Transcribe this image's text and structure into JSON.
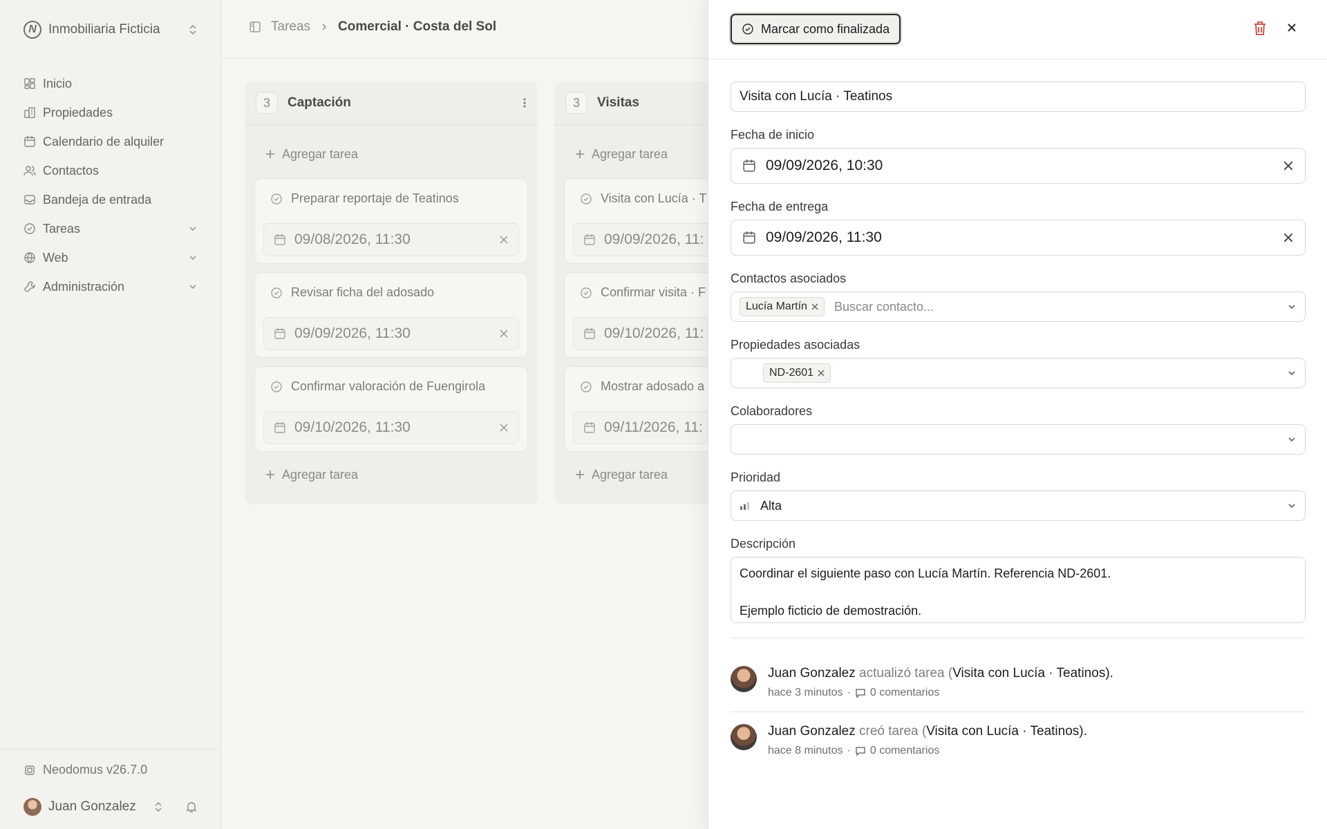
{
  "sidebar": {
    "org_name": "Inmobiliaria Ficticia",
    "logo_letter": "N",
    "nav": [
      {
        "label": "Inicio",
        "icon": "dashboard-icon"
      },
      {
        "label": "Propiedades",
        "icon": "building-icon"
      },
      {
        "label": "Calendario de alquiler",
        "icon": "calendar-icon"
      },
      {
        "label": "Contactos",
        "icon": "users-icon"
      },
      {
        "label": "Bandeja de entrada",
        "icon": "inbox-icon"
      },
      {
        "label": "Tareas",
        "icon": "check-circle-icon",
        "expandable": true
      },
      {
        "label": "Web",
        "icon": "globe-icon",
        "expandable": true
      },
      {
        "label": "Administración",
        "icon": "wrench-icon",
        "expandable": true
      }
    ],
    "version": "Neodomus v26.7.0",
    "user_name": "Juan Gonzalez"
  },
  "breadcrumb": {
    "parent": "Tareas",
    "current": "Comercial · Costa del Sol"
  },
  "board": {
    "add_task_label": "Agregar tarea",
    "columns": [
      {
        "count": "3",
        "title": "Captación",
        "cards": [
          {
            "title": "Preparar reportaje de Teatinos",
            "date": "09/08/2026, 11:30"
          },
          {
            "title": "Revisar ficha del adosado",
            "date": "09/09/2026, 11:30"
          },
          {
            "title": "Confirmar valoración de Fuengirola",
            "date": "09/10/2026, 11:30"
          }
        ]
      },
      {
        "count": "3",
        "title": "Visitas",
        "cards": [
          {
            "title": "Visita con Lucía · T",
            "date": "09/09/2026, 11:"
          },
          {
            "title": "Confirmar visita · F",
            "date": "09/10/2026, 11:"
          },
          {
            "title": "Mostrar adosado a",
            "date": "09/11/2026, 11:"
          }
        ]
      }
    ]
  },
  "panel": {
    "finish_label": "Marcar como finalizada",
    "task_title": "Visita con Lucía · Teatinos",
    "start_label": "Fecha de inicio",
    "start_value": "09/09/2026, 10:30",
    "due_label": "Fecha de entrega",
    "due_value": "09/09/2026, 11:30",
    "contacts_label": "Contactos asociados",
    "contact_chip": "Lucía Martín",
    "contact_placeholder": "Buscar contacto...",
    "properties_label": "Propiedades asociadas",
    "property_chip": "ND-2601",
    "collaborators_label": "Colaboradores",
    "priority_label": "Prioridad",
    "priority_value": "Alta",
    "description_label": "Descripción",
    "description_line1": "Coordinar el siguiente paso con Lucía Martín. Referencia ND-2601.",
    "description_line2": "Ejemplo ficticio de demostración.",
    "activity": [
      {
        "user": "Juan Gonzalez",
        "verb": "actualizó tarea (",
        "task": "Visita con Lucía · Teatinos",
        "end": ").",
        "time": "hace 3 minutos",
        "comments": "0 comentarios"
      },
      {
        "user": "Juan Gonzalez",
        "verb": "creó tarea (",
        "task": "Visita con Lucía · Teatinos",
        "end": ").",
        "time": "hace 8 minutos",
        "comments": "0 comentarios"
      }
    ]
  },
  "colors": {
    "danger": "#d9443f",
    "background": "#f6f5f1",
    "panel": "#ffffff"
  }
}
